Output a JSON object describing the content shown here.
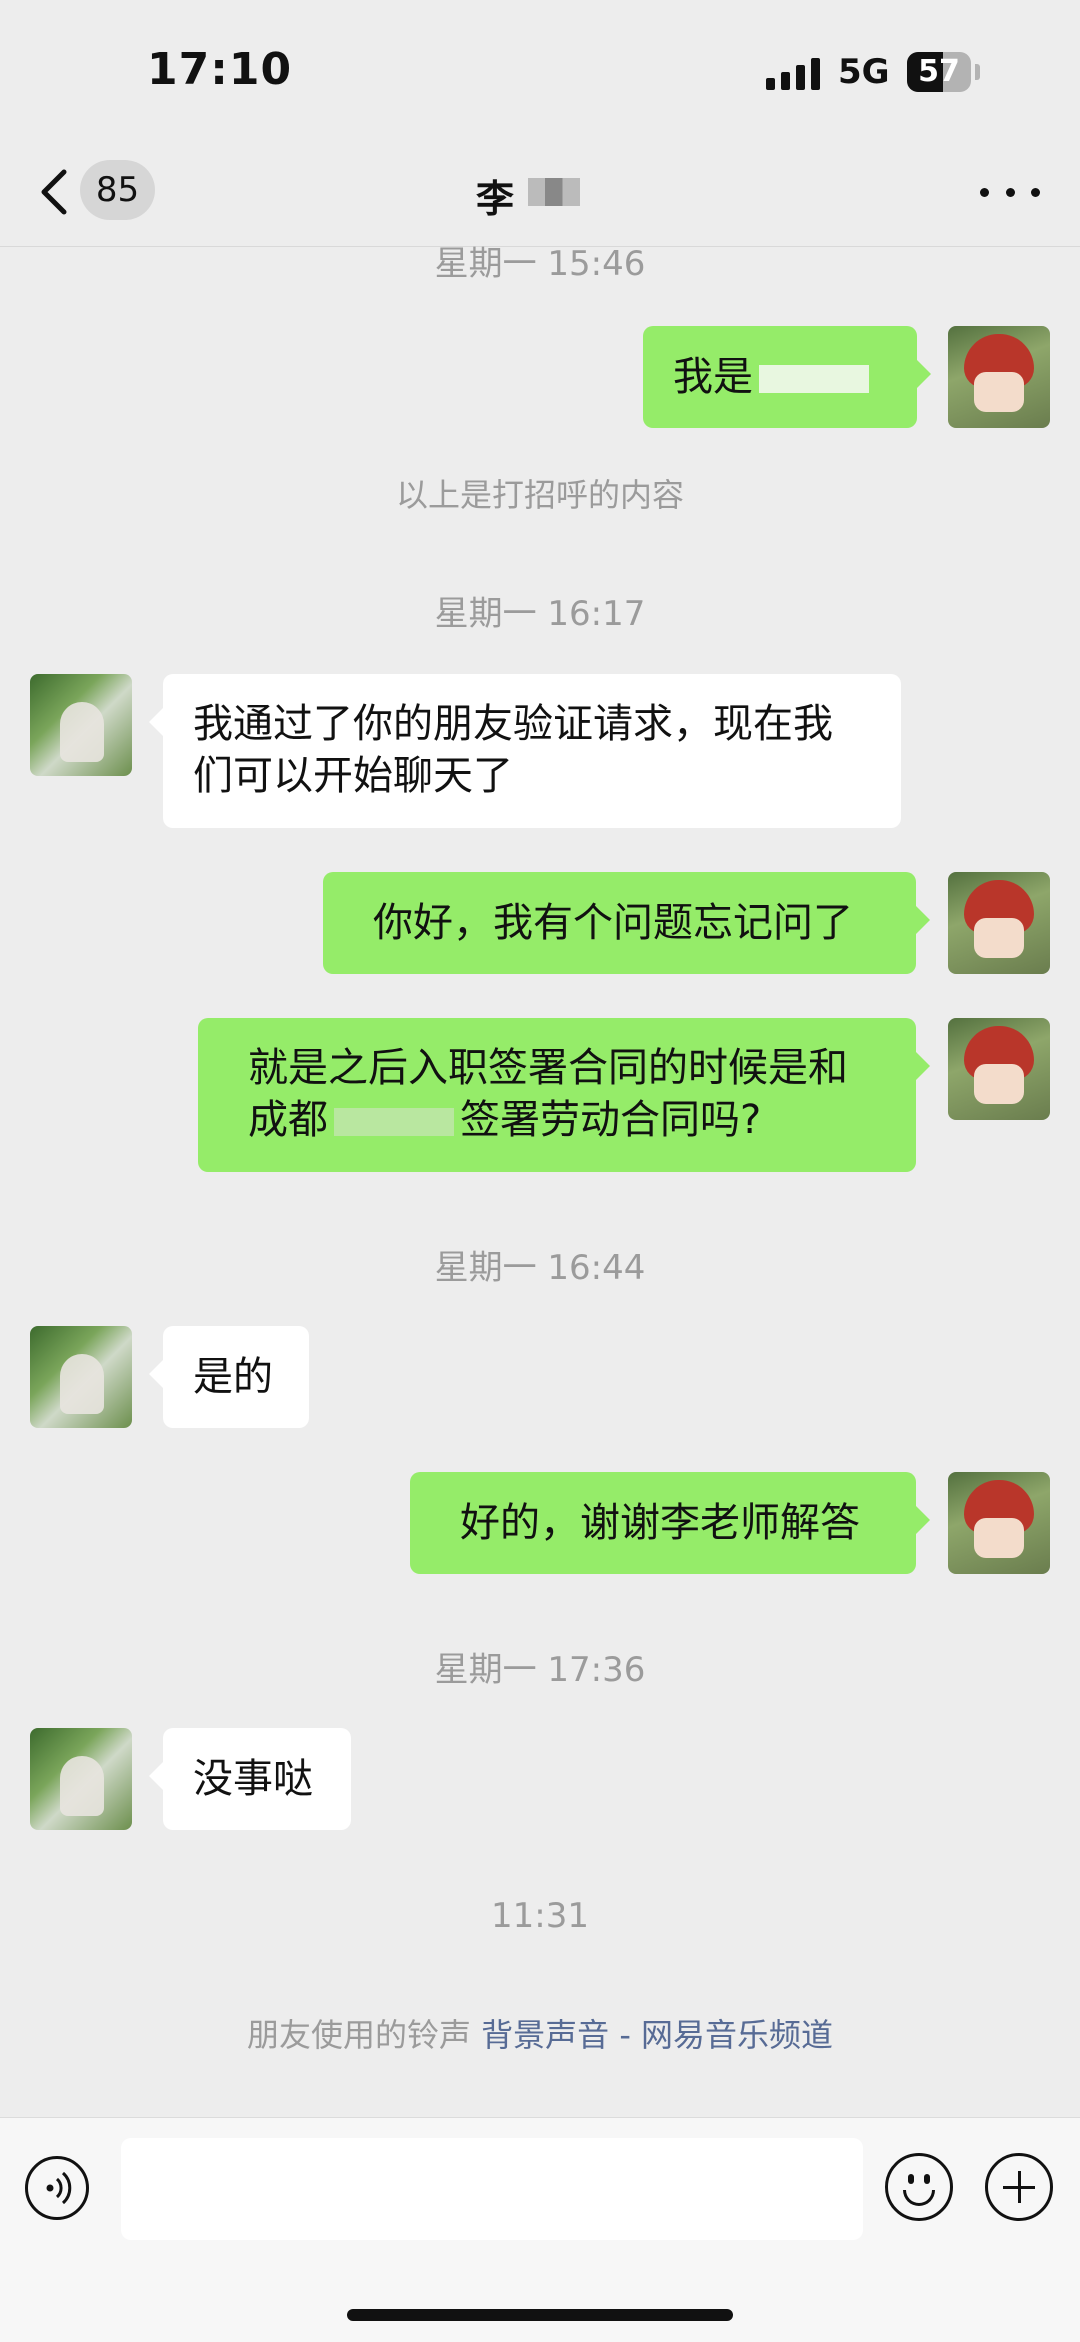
{
  "status_bar": {
    "time": "17:10",
    "network": "5G",
    "battery_level": "57"
  },
  "nav": {
    "unread_count": "85",
    "contact_name": "李"
  },
  "messages": {
    "ts1": "星期一 15:46",
    "m1_prefix": "我是",
    "greeting_note": "以上是打招呼的内容",
    "ts2": "星期一 16:17",
    "m2": "我通过了你的朋友验证请求，现在我们可以开始聊天了",
    "m3": "你好，我有个问题忘记问了",
    "m4_line1": "就是之后入职签署合同的时候是和",
    "m4_line2_prefix": "成都",
    "m4_line2_suffix": "签署劳动合同吗?",
    "ts3": "星期一 16:44",
    "m5": "是的",
    "m6": "好的，谢谢李老师解答",
    "ts4": "星期一 17:36",
    "m7": "没事哒",
    "ts5": "11:31"
  },
  "ringtone": {
    "prefix": "朋友使用的铃声",
    "link": "背景声音 - 网易音乐频道"
  },
  "input": {
    "placeholder": ""
  }
}
